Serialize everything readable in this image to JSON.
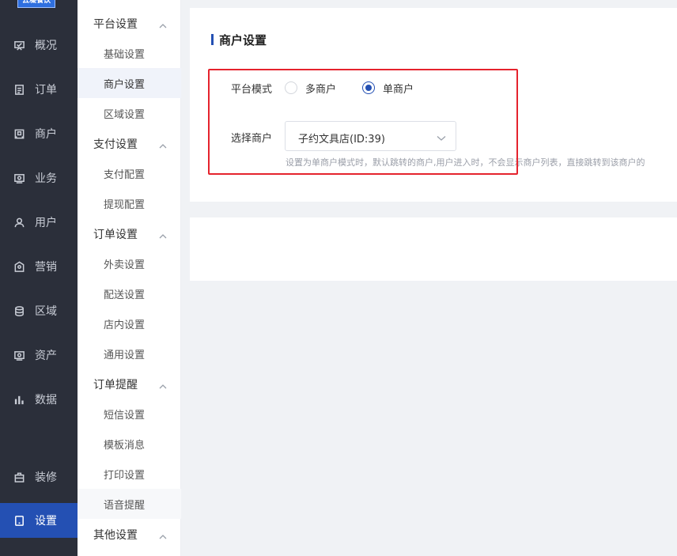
{
  "nav": {
    "logo_text": "云凝餐饮",
    "items": [
      {
        "label": "概况",
        "icon": "dashboard-icon"
      },
      {
        "label": "订单",
        "icon": "order-icon"
      },
      {
        "label": "商户",
        "icon": "store-icon"
      },
      {
        "label": "业务",
        "icon": "business-icon"
      },
      {
        "label": "用户",
        "icon": "user-icon"
      },
      {
        "label": "营销",
        "icon": "marketing-icon"
      },
      {
        "label": "区域",
        "icon": "database-icon"
      },
      {
        "label": "资产",
        "icon": "asset-icon"
      },
      {
        "label": "数据",
        "icon": "bar-chart-icon"
      },
      {
        "label": "装修",
        "icon": "decoration-icon"
      },
      {
        "label": "设置",
        "icon": "settings-icon"
      }
    ],
    "active": "设置"
  },
  "submenu": {
    "groups": [
      {
        "label": "平台设置",
        "items": [
          "基础设置",
          "商户设置",
          "区域设置"
        ]
      },
      {
        "label": "支付设置",
        "items": [
          "支付配置",
          "提现配置"
        ]
      },
      {
        "label": "订单设置",
        "items": [
          "外卖设置",
          "配送设置",
          "店内设置",
          "通用设置"
        ]
      },
      {
        "label": "订单提醒",
        "items": [
          "短信设置",
          "模板消息",
          "打印设置",
          "语音提醒"
        ]
      },
      {
        "label": "其他设置",
        "items": []
      }
    ],
    "active": "商户设置"
  },
  "main": {
    "title": "商户设置",
    "platform_mode": {
      "label": "平台模式",
      "options": [
        "多商户",
        "单商户"
      ],
      "selected": "单商户"
    },
    "select_merchant": {
      "label": "选择商户",
      "value": "子约文具店(ID:39)",
      "hint": "设置为单商户模式时，默认跳转的商户,用户进入时，不会显示商户列表，直接跳转到该商户的"
    }
  },
  "colors": {
    "nav_bg": "#2b2f3a",
    "accent": "#2450b3",
    "highlight_box": "#e5232d"
  }
}
